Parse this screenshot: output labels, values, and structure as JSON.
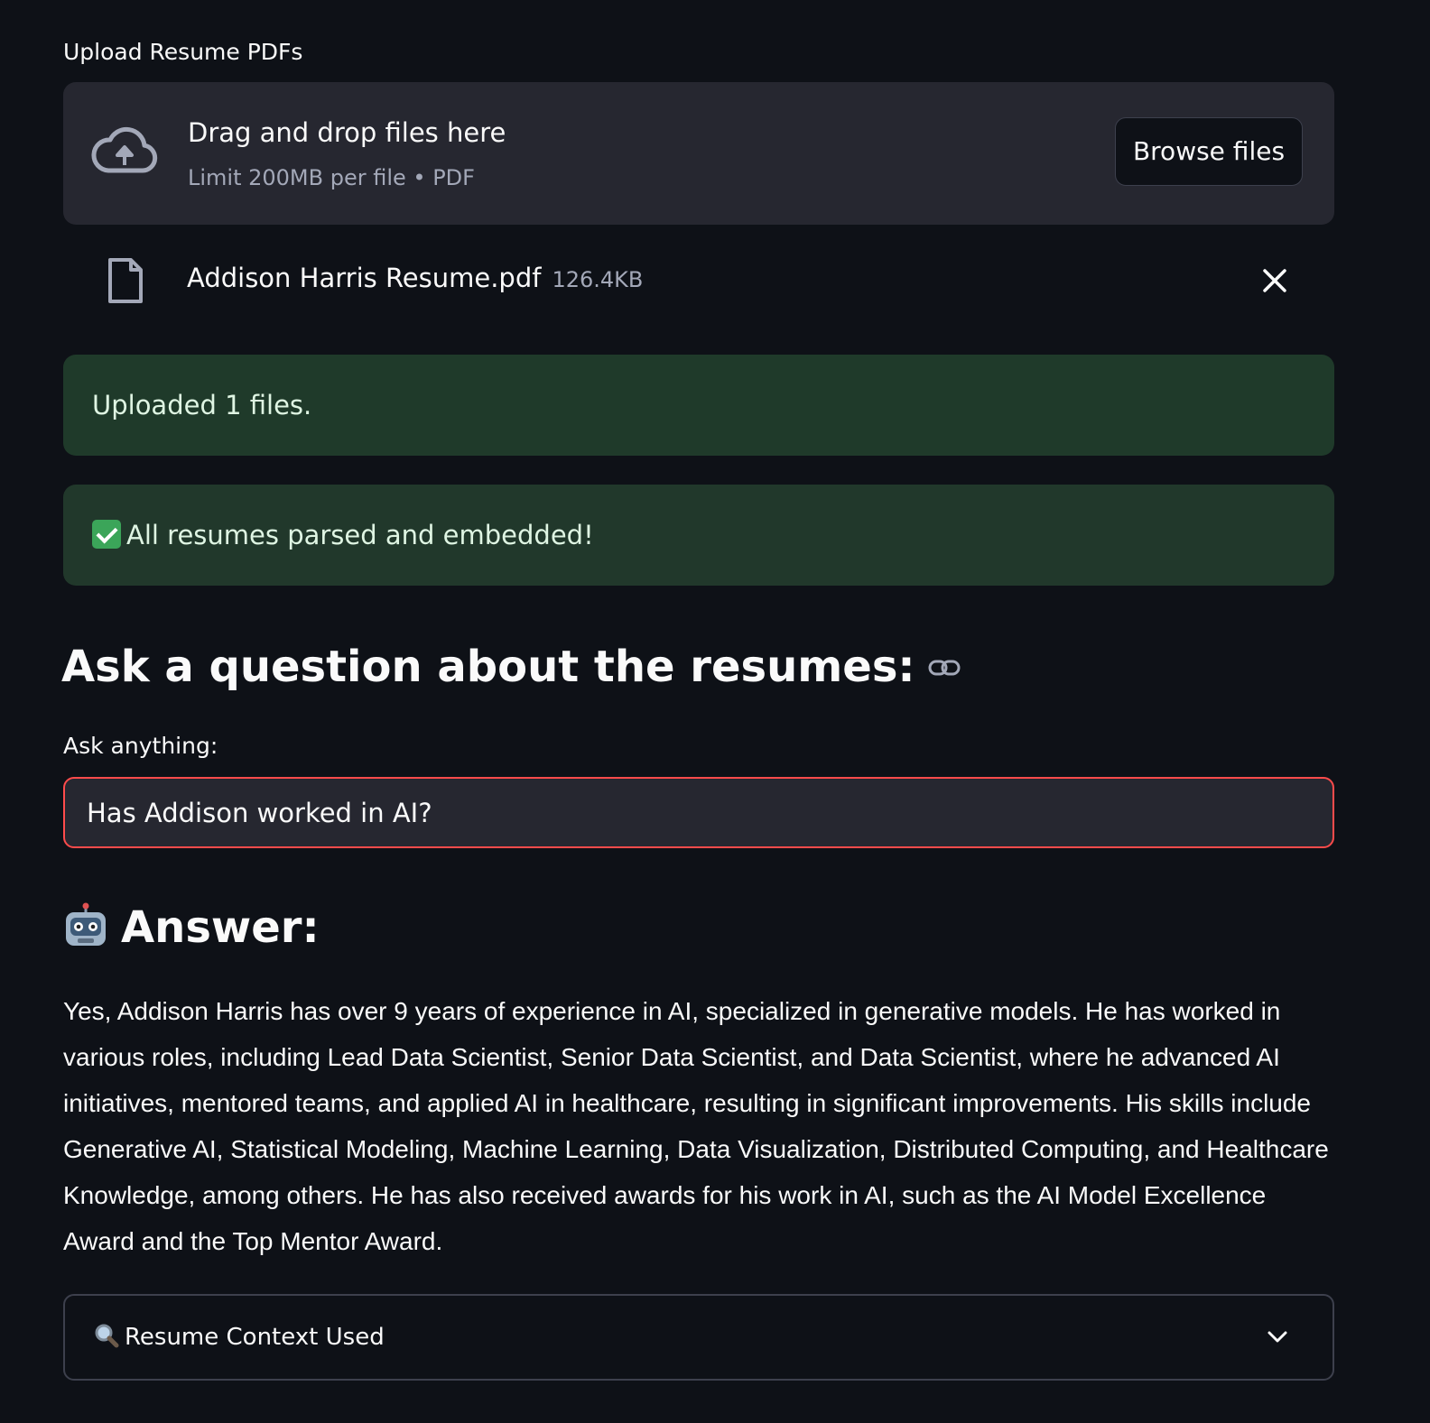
{
  "uploader": {
    "label": "Upload Resume PDFs",
    "drop_title": "Drag and drop files here",
    "drop_subtitle": "Limit 200MB per file • PDF",
    "browse_label": "Browse files",
    "icon": "cloud-upload-icon"
  },
  "files": [
    {
      "name": "Addison Harris Resume.pdf",
      "size": "126.4KB",
      "icon": "file-icon"
    }
  ],
  "alerts": {
    "uploaded": "Uploaded 1 files.",
    "parsed": "All resumes parsed and embedded!"
  },
  "question": {
    "heading": "Ask a question about the resumes:",
    "label": "Ask anything:",
    "value": "Has Addison worked in AI?"
  },
  "answer": {
    "heading": "Answer:",
    "text": "Yes, Addison Harris has over 9 years of experience in AI, specialized in generative models. He has worked in various roles, including Lead Data Scientist, Senior Data Scientist, and Data Scientist, where he advanced AI initiatives, mentored teams, and applied AI in healthcare, resulting in significant improvements. His skills include Generative AI, Statistical Modeling, Machine Learning, Data Visualization, Distributed Computing, and Healthcare Knowledge, among others. He has also received awards for his work in AI, such as the AI Model Excellence Award and the Top Mentor Award."
  },
  "expander": {
    "label": "Resume Context Used",
    "icon": "magnifier-icon"
  },
  "colors": {
    "background": "#0e1117",
    "panel": "#262730",
    "success_bg": "#1f3a2a",
    "input_border": "#ff4b4b",
    "muted_text": "#a3a8b8"
  }
}
